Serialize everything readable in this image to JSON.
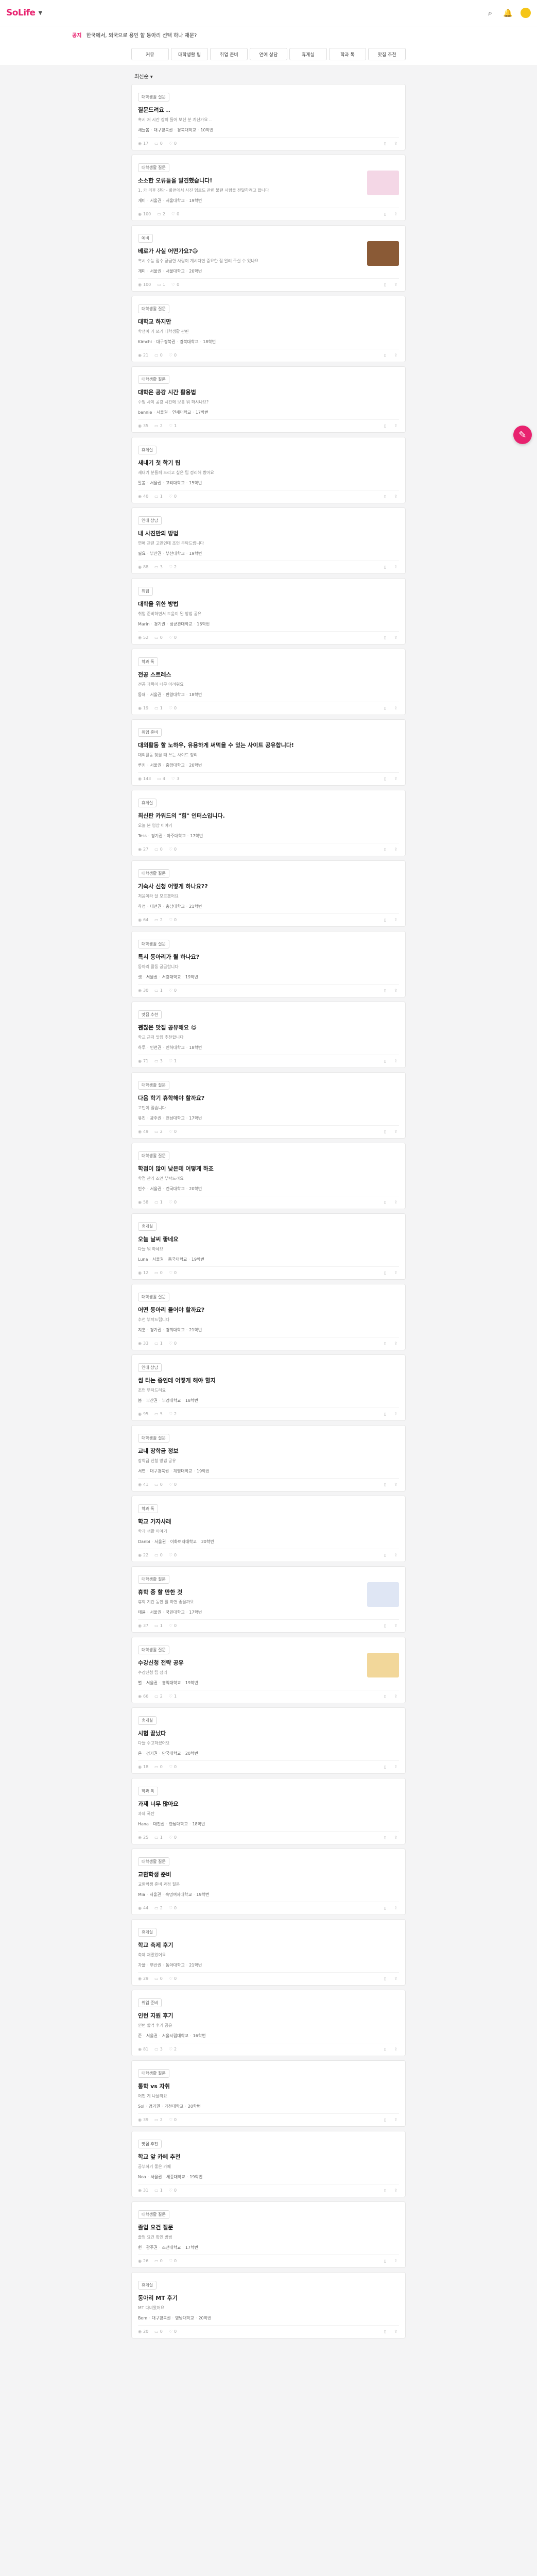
{
  "header": {
    "logo": "SoLife",
    "notice_badge": "공지",
    "notice_text": "한국에서, 외국으로 용인 할 동아리 선택 하나 재문?"
  },
  "tabs": [
    "커뮤",
    "대학생활 팁",
    "취업 준비",
    "연애 상담",
    "휴게실",
    "학과 톡",
    "맛집 추천"
  ],
  "sort_label": "최신순 ▾",
  "posts": [
    {
      "badge": "대학생활 질문",
      "title": "질문드려요 ..",
      "excerpt": "혹시 저 시간 강의 들어 보신 분 계신가요 ..",
      "meta": [
        "새늘봄",
        "대구경북권",
        "경북대학교",
        "10학번"
      ],
      "views": "17",
      "comments": "0",
      "likes": "0"
    },
    {
      "badge": "대학생활 질문",
      "title": "소소한 오류들을 발견했습니다!",
      "excerpt": "1. 카 리후 진단 - 화면에서 사진 업로드 관련 불편 사항을 전달하려고 합니다",
      "meta": [
        "개미",
        "서울권",
        "서울대학교",
        "19학번"
      ],
      "views": "100",
      "comments": "2",
      "likes": "0",
      "thumb": "#f4d7e6"
    },
    {
      "badge": "예비",
      "title": "베로가 사실 어떤가요?😄",
      "excerpt": "혹시 수능 점수 궁금한 사람이 계시다면 중요한 점 알려 주실 수 있나요",
      "meta": [
        "개미",
        "서울권",
        "서울대학교",
        "20학번"
      ],
      "views": "100",
      "comments": "1",
      "likes": "0",
      "thumb": "#8a5a36"
    },
    {
      "badge": "대학생활 질문",
      "title": "대학교 하지만",
      "excerpt": "학생이 가 쓰기 대학생활 관련",
      "meta": [
        "Kimchi",
        "대구경북권",
        "경북대학교",
        "18학번"
      ],
      "views": "21",
      "comments": "0",
      "likes": "0"
    },
    {
      "badge": "대학생활 질문",
      "title": "대학은 공강 시간 활용법",
      "excerpt": "수업 사이 공강 시간에 보통 뭐 하시나요?",
      "meta": [
        "bannie",
        "서울권",
        "연세대학교",
        "17학번"
      ],
      "views": "35",
      "comments": "2",
      "likes": "1"
    },
    {
      "badge": "휴게실",
      "title": "새내기 첫 학기 팁",
      "excerpt": "새내기 분들께 드리고 싶은 팁 정리해 봤어요",
      "meta": [
        "말봄",
        "서울권",
        "고려대학교",
        "15학번"
      ],
      "views": "40",
      "comments": "1",
      "likes": "0"
    },
    {
      "badge": "연애 상담",
      "title": "내 사진만의 방법",
      "excerpt": "연애 관련 고민인데 조언 부탁드립니다",
      "meta": [
        "필요",
        "부산권",
        "부산대학교",
        "19학번"
      ],
      "views": "88",
      "comments": "3",
      "likes": "2"
    },
    {
      "badge": "취업",
      "title": "대학을 위한 방법",
      "excerpt": "취업 준비하면서 도움이 된 방법 공유",
      "meta": [
        "Marin",
        "경기권",
        "성균관대학교",
        "16학번"
      ],
      "views": "52",
      "comments": "0",
      "likes": "0"
    },
    {
      "badge": "학과 톡",
      "title": "전공 스트레스",
      "excerpt": "전공 과목이 너무 어려워요",
      "meta": [
        "동재",
        "서울권",
        "한양대학교",
        "18학번"
      ],
      "views": "19",
      "comments": "1",
      "likes": "0"
    },
    {
      "badge": "취업 준비",
      "title": "대외활동 할 노하우, 유용하게 써먹을 수 있는 사이트 공유합니다!",
      "excerpt": "대외활동 찾을 때 쓰는 사이트 정리",
      "meta": [
        "루키",
        "서울권",
        "중앙대학교",
        "20학번"
      ],
      "views": "143",
      "comments": "4",
      "likes": "3"
    },
    {
      "badge": "휴게실",
      "title": "최신판 카워드의 \"힘\" 인터스입니다.",
      "excerpt": "오늘 본 영상 이야기",
      "meta": [
        "Tess",
        "경기권",
        "아주대학교",
        "17학번"
      ],
      "views": "27",
      "comments": "0",
      "likes": "0"
    },
    {
      "badge": "대학생활 질문",
      "title": "기숙사 신청 어떻게 하나요??",
      "excerpt": "처음이라 잘 모르겠어요",
      "meta": [
        "하정",
        "대전권",
        "충남대학교",
        "21학번"
      ],
      "views": "64",
      "comments": "2",
      "likes": "0"
    },
    {
      "badge": "대학생활 질문",
      "title": "특시 동아리가 뭘 하나요?",
      "excerpt": "동아리 활동 궁금합니다",
      "meta": [
        "셋",
        "서울권",
        "서강대학교",
        "19학번"
      ],
      "views": "30",
      "comments": "1",
      "likes": "0"
    },
    {
      "badge": "맛집 추천",
      "title": "괜찮은 맛집 공유해요 😋",
      "excerpt": "학교 근처 맛집 추천합니다",
      "meta": [
        "하루",
        "인천권",
        "인하대학교",
        "18학번"
      ],
      "views": "71",
      "comments": "3",
      "likes": "1"
    },
    {
      "badge": "대학생활 질문",
      "title": "다음 학기 휴학해야 할까요?",
      "excerpt": "고민이 많습니다",
      "meta": [
        "유진",
        "광주권",
        "전남대학교",
        "17학번"
      ],
      "views": "49",
      "comments": "2",
      "likes": "0"
    },
    {
      "badge": "대학생활 질문",
      "title": "학점이 많이 낮은데 어떻게 하죠",
      "excerpt": "학점 관리 조언 부탁드려요",
      "meta": [
        "민수",
        "서울권",
        "건국대학교",
        "20학번"
      ],
      "views": "58",
      "comments": "1",
      "likes": "0"
    },
    {
      "badge": "휴게실",
      "title": "오늘 날씨 좋네요",
      "excerpt": "다들 뭐 하세요",
      "meta": [
        "Luna",
        "서울권",
        "동국대학교",
        "19학번"
      ],
      "views": "12",
      "comments": "0",
      "likes": "0"
    },
    {
      "badge": "대학생활 질문",
      "title": "어떤 동아리 들어야 할까요?",
      "excerpt": "추천 부탁드립니다",
      "meta": [
        "지훈",
        "경기권",
        "경희대학교",
        "21학번"
      ],
      "views": "33",
      "comments": "1",
      "likes": "0"
    },
    {
      "badge": "연애 상담",
      "title": "썸 타는 중인데 어떻게 해야 할지",
      "excerpt": "조언 부탁드려요",
      "meta": [
        "봄",
        "부산권",
        "부경대학교",
        "18학번"
      ],
      "views": "95",
      "comments": "5",
      "likes": "2"
    },
    {
      "badge": "대학생활 질문",
      "title": "교내 장학금 정보",
      "excerpt": "장학금 신청 방법 공유",
      "meta": [
        "서연",
        "대구경북권",
        "계명대학교",
        "19학번"
      ],
      "views": "41",
      "comments": "0",
      "likes": "0"
    },
    {
      "badge": "학과 톡",
      "title": "학교 가자사래",
      "excerpt": "학과 생활 이야기",
      "meta": [
        "Danbi",
        "서울권",
        "이화여자대학교",
        "20학번"
      ],
      "views": "22",
      "comments": "0",
      "likes": "0"
    },
    {
      "badge": "대학생활 질문",
      "title": "휴학 중 할 만한 것",
      "excerpt": "휴학 기간 동안 뭘 하면 좋을까요",
      "meta": [
        "태윤",
        "서울권",
        "국민대학교",
        "17학번"
      ],
      "views": "37",
      "comments": "1",
      "likes": "0",
      "thumb": "#dfe6f4"
    },
    {
      "badge": "대학생활 질문",
      "title": "수강신청 전략 공유",
      "excerpt": "수강신청 팁 정리",
      "meta": [
        "별",
        "서울권",
        "홍익대학교",
        "19학번"
      ],
      "views": "66",
      "comments": "2",
      "likes": "1",
      "thumb": "#f2d79a"
    },
    {
      "badge": "휴게실",
      "title": "시험 끝났다",
      "excerpt": "다들 수고하셨어요",
      "meta": [
        "윤",
        "경기권",
        "단국대학교",
        "20학번"
      ],
      "views": "18",
      "comments": "0",
      "likes": "0"
    },
    {
      "badge": "학과 톡",
      "title": "과제 너무 많아요",
      "excerpt": "과제 폭탄",
      "meta": [
        "Hana",
        "대전권",
        "한남대학교",
        "18학번"
      ],
      "views": "25",
      "comments": "1",
      "likes": "0"
    },
    {
      "badge": "대학생활 질문",
      "title": "교환학생 준비",
      "excerpt": "교환학생 준비 과정 질문",
      "meta": [
        "Mia",
        "서울권",
        "숙명여자대학교",
        "19학번"
      ],
      "views": "44",
      "comments": "2",
      "likes": "0"
    },
    {
      "badge": "휴게실",
      "title": "학교 축제 후기",
      "excerpt": "축제 재밌었어요",
      "meta": [
        "가을",
        "부산권",
        "동아대학교",
        "21학번"
      ],
      "views": "29",
      "comments": "0",
      "likes": "0"
    },
    {
      "badge": "취업 준비",
      "title": "인턴 지원 후기",
      "excerpt": "인턴 합격 후기 공유",
      "meta": [
        "준",
        "서울권",
        "서울시립대학교",
        "16학번"
      ],
      "views": "81",
      "comments": "3",
      "likes": "2"
    },
    {
      "badge": "대학생활 질문",
      "title": "통학 vs 자취",
      "excerpt": "어떤 게 나을까요",
      "meta": [
        "Sol",
        "경기권",
        "가천대학교",
        "20학번"
      ],
      "views": "39",
      "comments": "2",
      "likes": "0"
    },
    {
      "badge": "맛집 추천",
      "title": "학교 앞 카페 추천",
      "excerpt": "공부하기 좋은 카페",
      "meta": [
        "Noa",
        "서울권",
        "세종대학교",
        "19학번"
      ],
      "views": "31",
      "comments": "1",
      "likes": "0"
    },
    {
      "badge": "대학생활 질문",
      "title": "졸업 요건 질문",
      "excerpt": "졸업 요건 확인 방법",
      "meta": [
        "현",
        "광주권",
        "조선대학교",
        "17학번"
      ],
      "views": "26",
      "comments": "0",
      "likes": "0"
    },
    {
      "badge": "휴게실",
      "title": "동아리 MT 후기",
      "excerpt": "MT 다녀왔어요",
      "meta": [
        "Bom",
        "대구경북권",
        "영남대학교",
        "20학번"
      ],
      "views": "20",
      "comments": "0",
      "likes": "0"
    }
  ]
}
